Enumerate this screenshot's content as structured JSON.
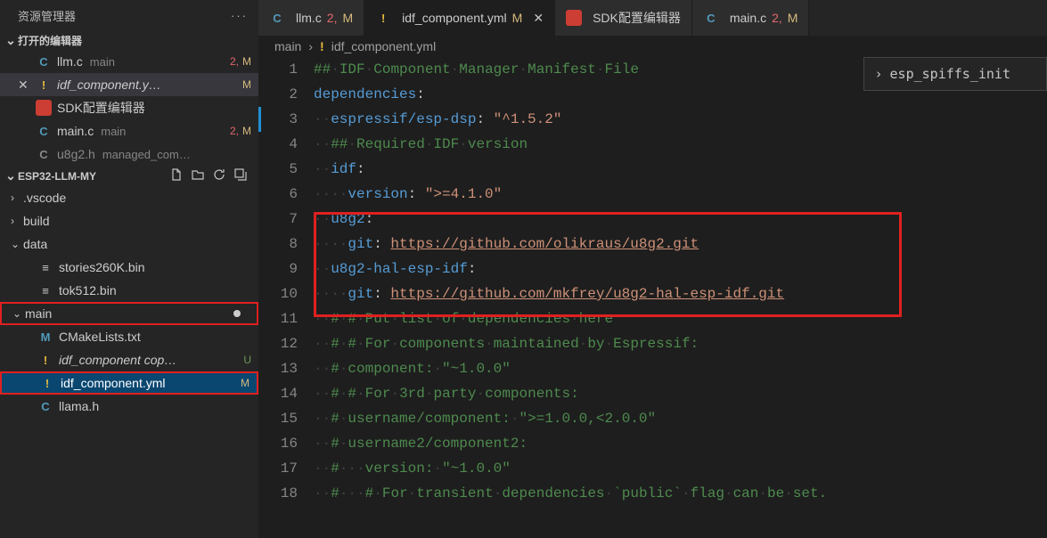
{
  "sidebar": {
    "title": "资源管理器",
    "open_editors_label": "打开的编辑器",
    "open_editors": [
      {
        "icon": "C",
        "iconClass": "ic-c",
        "name": "llm.c",
        "desc": "main",
        "num": "2,",
        "m": "M",
        "active": false
      },
      {
        "icon": "!",
        "iconClass": "ic-yml-warn",
        "name": "idf_component.y…",
        "desc": "",
        "num": "",
        "m": "M",
        "active": true,
        "italic": true
      },
      {
        "icon": "",
        "iconClass": "ic-sdk",
        "name": "SDK配置编辑器",
        "desc": "",
        "num": "",
        "m": "",
        "active": false
      },
      {
        "icon": "C",
        "iconClass": "ic-c",
        "name": "main.c",
        "desc": "main",
        "num": "2,",
        "m": "M",
        "active": false
      },
      {
        "icon": "C",
        "iconClass": "ic-c muted",
        "name": "u8g2.h",
        "desc": "managed_com…",
        "num": "",
        "m": "",
        "active": false,
        "muted": true
      }
    ],
    "project": "ESP32-LLM-MY",
    "tree": [
      {
        "type": "folder",
        "chev": "›",
        "name": ".vscode",
        "depth": 0
      },
      {
        "type": "folder",
        "chev": "›",
        "name": "build",
        "depth": 0
      },
      {
        "type": "folder",
        "chev": "⌄",
        "name": "data",
        "depth": 0
      },
      {
        "type": "file",
        "icon": "≡",
        "iconClass": "",
        "name": "stories260K.bin",
        "depth": 1
      },
      {
        "type": "file",
        "icon": "≡",
        "iconClass": "",
        "name": "tok512.bin",
        "depth": 1
      },
      {
        "type": "folder",
        "chev": "⌄",
        "name": "main",
        "depth": 0,
        "redbox": true,
        "dot": true
      },
      {
        "type": "file",
        "icon": "M",
        "iconClass": "ic-m",
        "name": "CMakeLists.txt",
        "depth": 1
      },
      {
        "type": "file",
        "icon": "!",
        "iconClass": "ic-yml-warn",
        "name": "idf_component cop…",
        "depth": 1,
        "status": "U",
        "statusClass": "stat-u",
        "italic": true
      },
      {
        "type": "file",
        "icon": "!",
        "iconClass": "ic-yml-warn",
        "name": "idf_component.yml",
        "depth": 1,
        "status": "M",
        "statusClass": "stat-m",
        "selected": true,
        "redbox": true
      },
      {
        "type": "file",
        "icon": "C",
        "iconClass": "ic-c",
        "name": "llama.h",
        "depth": 1
      }
    ]
  },
  "tabs": [
    {
      "icon": "C",
      "iconClass": "ic-c",
      "name": "llm.c",
      "num": "2,",
      "m": "M",
      "active": false
    },
    {
      "icon": "!",
      "iconClass": "ic-yml-warn",
      "name": "idf_component.yml",
      "num": "",
      "m": "M",
      "active": true,
      "italic": true,
      "close": true
    },
    {
      "icon": "",
      "iconClass": "ic-sdk",
      "name": "SDK配置编辑器",
      "num": "",
      "m": "",
      "active": false
    },
    {
      "icon": "C",
      "iconClass": "ic-c",
      "name": "main.c",
      "num": "2,",
      "m": "M",
      "active": false
    }
  ],
  "breadcrumb": {
    "folder": "main",
    "sep": "›",
    "icon": "!",
    "file": "idf_component.yml"
  },
  "outline": {
    "sep": "›",
    "text": "esp_spiffs_init"
  },
  "code": {
    "lines": [
      {
        "n": 1,
        "segs": [
          {
            "t": "## IDF Component Manager Manifest File",
            "c": "com",
            "ws": true
          }
        ]
      },
      {
        "n": 2,
        "segs": [
          {
            "t": "dependencies",
            "c": "kw"
          },
          {
            "t": ":",
            "c": ""
          }
        ]
      },
      {
        "n": 3,
        "diff": true,
        "segs": [
          {
            "t": "  ",
            "c": "ws"
          },
          {
            "t": "espressif/esp-dsp",
            "c": "kw"
          },
          {
            "t": ": ",
            "c": ""
          },
          {
            "t": "\"^1.5.2\"",
            "c": "str"
          }
        ]
      },
      {
        "n": 4,
        "segs": [
          {
            "t": "  ",
            "c": "ws"
          },
          {
            "t": "## Required IDF version",
            "c": "com",
            "ws": true
          }
        ]
      },
      {
        "n": 5,
        "segs": [
          {
            "t": "  ",
            "c": "ws"
          },
          {
            "t": "idf",
            "c": "kw"
          },
          {
            "t": ":",
            "c": ""
          }
        ]
      },
      {
        "n": 6,
        "segs": [
          {
            "t": "    ",
            "c": "ws"
          },
          {
            "t": "version",
            "c": "kw"
          },
          {
            "t": ": ",
            "c": ""
          },
          {
            "t": "\">=4.1.0\"",
            "c": "str"
          }
        ]
      },
      {
        "n": 7,
        "segs": [
          {
            "t": "  ",
            "c": "ws"
          },
          {
            "t": "u8g2",
            "c": "kw"
          },
          {
            "t": ":",
            "c": ""
          }
        ]
      },
      {
        "n": 8,
        "segs": [
          {
            "t": "    ",
            "c": "ws"
          },
          {
            "t": "git",
            "c": "kw"
          },
          {
            "t": ": ",
            "c": ""
          },
          {
            "t": "https://github.com/olikraus/u8g2.git",
            "c": "link"
          }
        ]
      },
      {
        "n": 9,
        "segs": [
          {
            "t": "  ",
            "c": "ws"
          },
          {
            "t": "u8g2-hal-esp-idf",
            "c": "kw"
          },
          {
            "t": ":",
            "c": ""
          }
        ]
      },
      {
        "n": 10,
        "segs": [
          {
            "t": "    ",
            "c": "ws"
          },
          {
            "t": "git",
            "c": "kw"
          },
          {
            "t": ": ",
            "c": ""
          },
          {
            "t": "https://github.com/mkfrey/u8g2-hal-esp-idf.git",
            "c": "link"
          }
        ]
      },
      {
        "n": 11,
        "segs": [
          {
            "t": "  ",
            "c": "ws"
          },
          {
            "t": "# # Put list of dependencies here",
            "c": "com",
            "ws": true
          }
        ]
      },
      {
        "n": 12,
        "segs": [
          {
            "t": "  ",
            "c": "ws"
          },
          {
            "t": "# # For components maintained by Espressif:",
            "c": "com",
            "ws": true
          }
        ]
      },
      {
        "n": 13,
        "segs": [
          {
            "t": "  ",
            "c": "ws"
          },
          {
            "t": "# component: \"~1.0.0\"",
            "c": "com",
            "ws": true
          }
        ]
      },
      {
        "n": 14,
        "segs": [
          {
            "t": "  ",
            "c": "ws"
          },
          {
            "t": "# # For 3rd party components:",
            "c": "com",
            "ws": true
          }
        ]
      },
      {
        "n": 15,
        "segs": [
          {
            "t": "  ",
            "c": "ws"
          },
          {
            "t": "# username/component: \">=1.0.0,<2.0.0\"",
            "c": "com",
            "ws": true
          }
        ]
      },
      {
        "n": 16,
        "segs": [
          {
            "t": "  ",
            "c": "ws"
          },
          {
            "t": "# username2/component2:",
            "c": "com",
            "ws": true
          }
        ]
      },
      {
        "n": 17,
        "segs": [
          {
            "t": "  ",
            "c": "ws"
          },
          {
            "t": "#   version: \"~1.0.0\"",
            "c": "com",
            "ws": true
          }
        ]
      },
      {
        "n": 18,
        "segs": [
          {
            "t": "  ",
            "c": "ws"
          },
          {
            "t": "#   # For transient dependencies `public` flag can be set.",
            "c": "com",
            "ws": true
          }
        ]
      }
    ]
  }
}
